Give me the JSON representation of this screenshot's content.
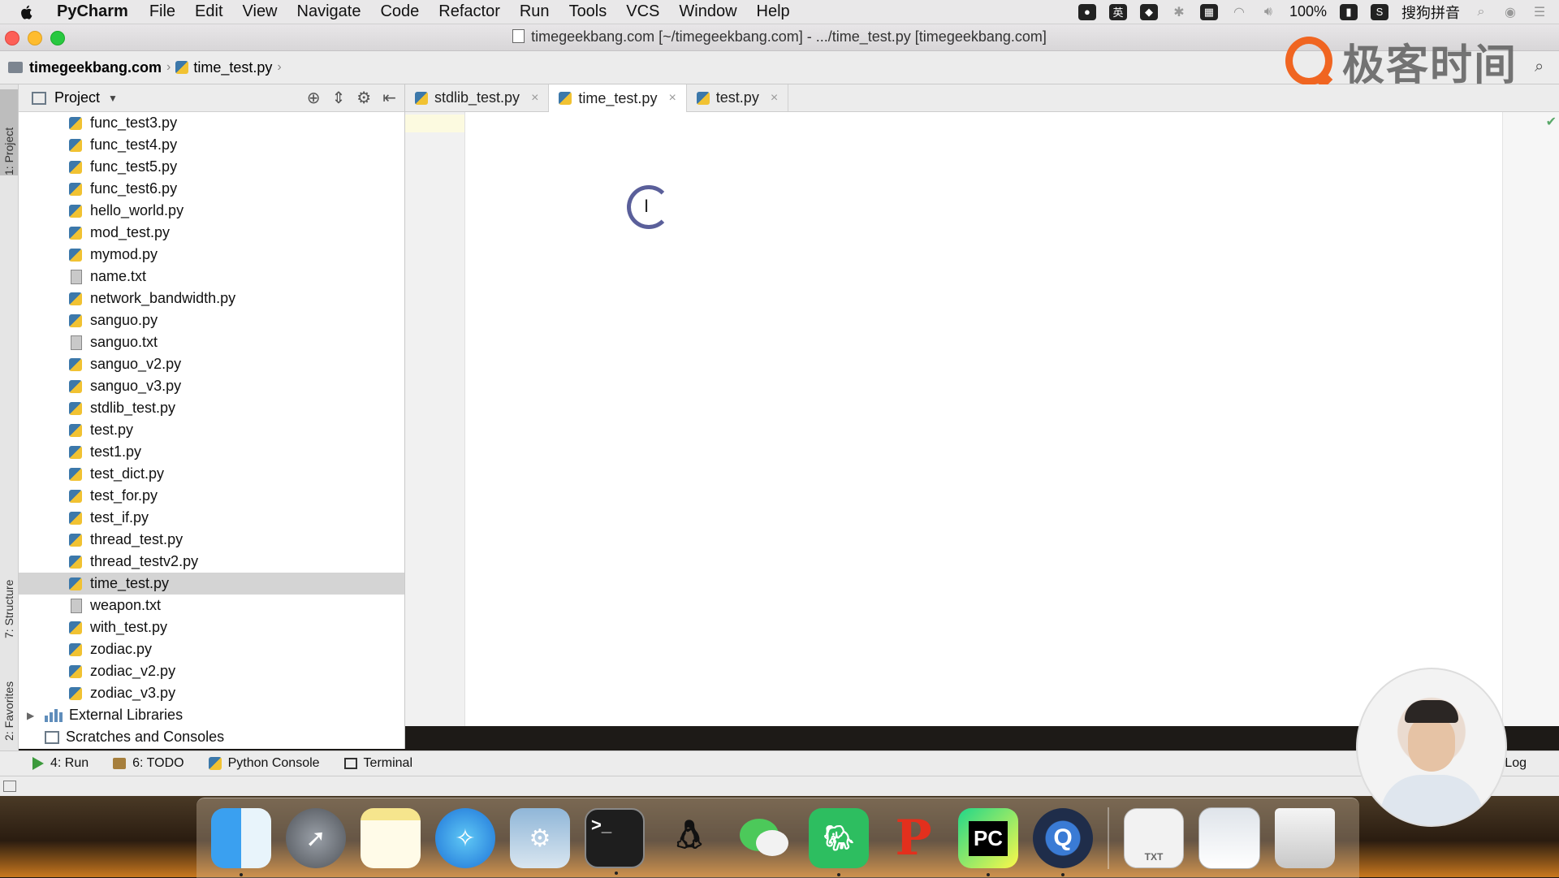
{
  "menubar": {
    "app_name": "PyCharm",
    "items": [
      "File",
      "Edit",
      "View",
      "Navigate",
      "Code",
      "Refactor",
      "Run",
      "Tools",
      "VCS",
      "Window",
      "Help"
    ],
    "ime_label": "英",
    "battery": "100%",
    "input_method": "搜狗拼音"
  },
  "window": {
    "title": "timegeekbang.com [~/timegeekbang.com] - .../time_test.py [timegeekbang.com]"
  },
  "navbar": {
    "project": "timegeekbang.com",
    "file": "time_test.py"
  },
  "logo": {
    "text": "极客时间"
  },
  "tool_stripe": {
    "project_tab": "1: Project",
    "structure_tab": "7: Structure",
    "favorites_tab": "2: Favorites"
  },
  "project_panel": {
    "title": "Project",
    "files": [
      {
        "name": "func_test3.py",
        "type": "py"
      },
      {
        "name": "func_test4.py",
        "type": "py"
      },
      {
        "name": "func_test5.py",
        "type": "py"
      },
      {
        "name": "func_test6.py",
        "type": "py"
      },
      {
        "name": "hello_world.py",
        "type": "py"
      },
      {
        "name": "mod_test.py",
        "type": "py"
      },
      {
        "name": "mymod.py",
        "type": "py"
      },
      {
        "name": "name.txt",
        "type": "txt"
      },
      {
        "name": "network_bandwidth.py",
        "type": "py"
      },
      {
        "name": "sanguo.py",
        "type": "py"
      },
      {
        "name": "sanguo.txt",
        "type": "txt"
      },
      {
        "name": "sanguo_v2.py",
        "type": "py"
      },
      {
        "name": "sanguo_v3.py",
        "type": "py"
      },
      {
        "name": "stdlib_test.py",
        "type": "py"
      },
      {
        "name": "test.py",
        "type": "py"
      },
      {
        "name": "test1.py",
        "type": "py"
      },
      {
        "name": "test_dict.py",
        "type": "py"
      },
      {
        "name": "test_for.py",
        "type": "py"
      },
      {
        "name": "test_if.py",
        "type": "py"
      },
      {
        "name": "thread_test.py",
        "type": "py"
      },
      {
        "name": "thread_testv2.py",
        "type": "py"
      },
      {
        "name": "time_test.py",
        "type": "py",
        "selected": true
      },
      {
        "name": "weapon.txt",
        "type": "txt"
      },
      {
        "name": "with_test.py",
        "type": "py"
      },
      {
        "name": "zodiac.py",
        "type": "py"
      },
      {
        "name": "zodiac_v2.py",
        "type": "py"
      },
      {
        "name": "zodiac_v3.py",
        "type": "py"
      }
    ],
    "external_libraries": "External Libraries",
    "scratches": "Scratches and Consoles"
  },
  "editor_tabs": [
    {
      "label": "stdlib_test.py",
      "active": false
    },
    {
      "label": "time_test.py",
      "active": true
    },
    {
      "label": "test.py",
      "active": false
    }
  ],
  "bottom_tools": {
    "run": "4: Run",
    "todo": "6: TODO",
    "python_console": "Python Console",
    "terminal": "Terminal",
    "log": "Log"
  },
  "dock": {
    "apps": [
      "finder",
      "launchpad",
      "notes",
      "safari",
      "system-preferences",
      "terminal",
      "qq",
      "wechat",
      "evernote",
      "wps",
      "pycharm",
      "quicktime",
      "txt-file",
      "preview",
      "trash"
    ],
    "pycharm_label": "PC",
    "txt_label": "TXT"
  },
  "colors": {
    "selection": "#d4d4d4",
    "accent_logo": "#f06521",
    "line_highlight": "#fcfae0"
  }
}
